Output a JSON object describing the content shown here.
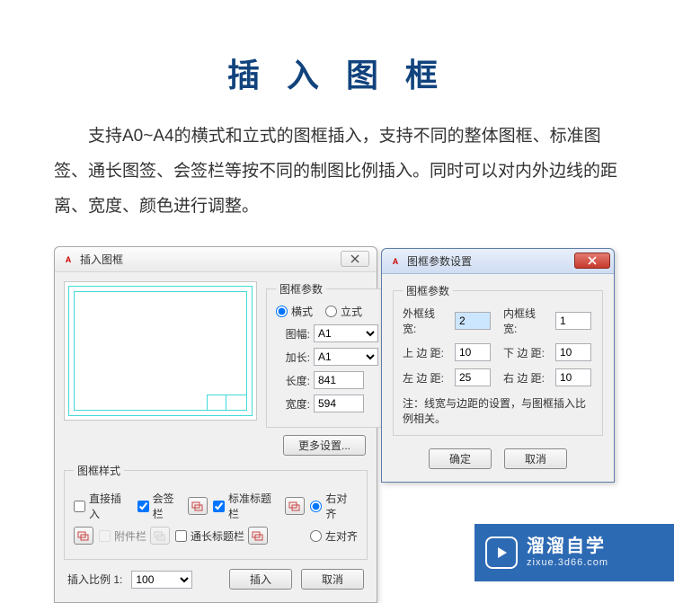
{
  "page": {
    "title": "插 入 图 框",
    "description": "支持A0~A4的横式和立式的图框插入，支持不同的整体图框、标准图签、通长图签、会签栏等按不同的制图比例插入。同时可以对内外边线的距离、宽度、颜色进行调整。"
  },
  "dialog1": {
    "title": "插入图框",
    "params_legend": "图框参数",
    "orient_h": "横式",
    "orient_v": "立式",
    "label_tufu": "图幅:",
    "value_tufu": "A1",
    "label_jiachang": "加长:",
    "value_jiachang": "A1",
    "label_length": "长度:",
    "value_length": "841",
    "label_width": "宽度:",
    "value_width": "594",
    "more_btn": "更多设置...",
    "style_legend": "图框样式",
    "ck_direct": "直接插入",
    "ck_huiqian": "会签栏",
    "ck_biaozhun": "标准标题栏",
    "ck_fujian": "附件栏",
    "ck_tongchang": "通长标题栏",
    "radio_right": "右对齐",
    "radio_left": "左对齐",
    "ratio_label": "插入比例 1:",
    "ratio_value": "100",
    "btn_insert": "插入",
    "btn_cancel": "取消",
    "close_icon": "close-icon"
  },
  "dialog2": {
    "title": "图框参数设置",
    "legend": "图框参数",
    "lbl_outer": "外框线宽:",
    "val_outer": "2",
    "lbl_inner": "内框线宽:",
    "val_inner": "1",
    "lbl_top": "上 边 距:",
    "val_top": "10",
    "lbl_bottom": "下 边 距:",
    "val_bottom": "10",
    "lbl_left": "左 边 距:",
    "val_left": "25",
    "lbl_right": "右 边 距:",
    "val_right": "10",
    "note": "注：线宽与边距的设置，与图框插入比例相关。",
    "ok": "确定",
    "cancel": "取消"
  },
  "watermark": {
    "brand": "溜溜自学",
    "url": "zixue.3d66.com"
  }
}
